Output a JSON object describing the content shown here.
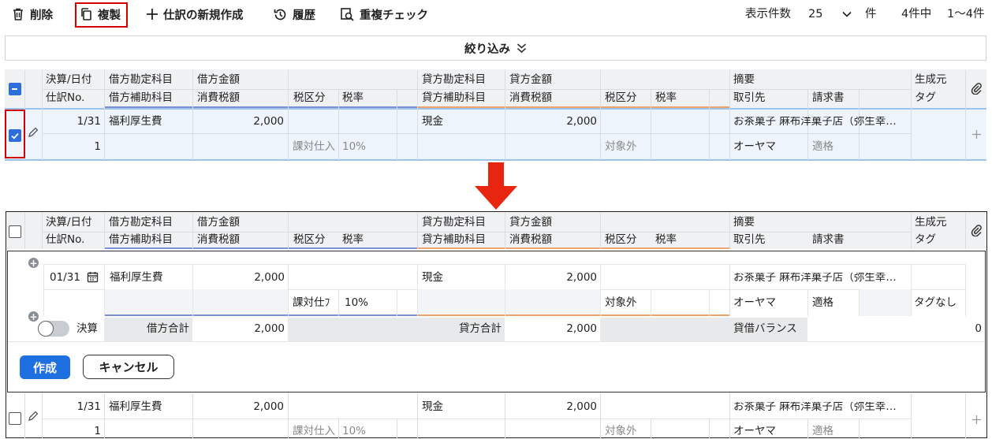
{
  "toolbar": {
    "delete": "削除",
    "duplicate": "複製",
    "new_entry": "仕訳の新規作成",
    "history": "履歴",
    "duplicate_check": "重複チェック",
    "display_count_label": "表示件数",
    "display_count_value": "25",
    "count_unit": "件",
    "total": "4件中",
    "range": "1〜4件"
  },
  "filter": {
    "label": "絞り込み"
  },
  "columns": {
    "date": "決算/日付",
    "entry_no": "仕訳No.",
    "debit_account": "借方勘定科目",
    "debit_sub": "借方補助科目",
    "debit_amount": "借方金額",
    "debit_tax_amount": "消費税額",
    "tax_category": "税区分",
    "tax_rate": "税率",
    "credit_account": "貸方勘定科目",
    "credit_sub": "貸方補助科目",
    "credit_amount": "貸方金額",
    "credit_tax_amount": "消費税額",
    "tax_category2": "税区分",
    "tax_rate2": "税率",
    "memo": "摘要",
    "partner": "取引先",
    "invoice": "請求書",
    "source": "生成元",
    "tag": "タグ"
  },
  "row": {
    "date": "1/31",
    "entry_no": "1",
    "debit_account": "福利厚生費",
    "debit_amount": "2,000",
    "tax_category": "課対仕入",
    "tax_rate": "10%",
    "credit_account": "現金",
    "credit_amount": "2,000",
    "credit_tax_category": "対象外",
    "memo": "お茶菓子 麻布洋菓子店（弥生幸…",
    "partner": "オーヤマ",
    "invoice": "適格"
  },
  "edit": {
    "date": "01/31",
    "debit_account": "福利厚生費",
    "debit_amount": "2,000",
    "tax_category": "課対仕ﾌ",
    "tax_rate": "10%",
    "credit_account": "現金",
    "credit_amount": "2,000",
    "credit_tax_category": "対象外",
    "memo": "お茶菓子 麻布洋菓子店（弥生幸…",
    "partner": "オーヤマ",
    "invoice": "適格",
    "tag": "タグなし",
    "closing_label": "決算",
    "debit_total_label": "借方合計",
    "debit_total": "2,000",
    "credit_total_label": "貸方合計",
    "credit_total": "2,000",
    "balance_label": "貸借バランス",
    "balance": "0",
    "create_button": "作成",
    "cancel_button": "キャンセル"
  },
  "colors": {
    "primary": "#1e6fe0",
    "highlight": "#d40000",
    "arrow": "#e8260f",
    "debit_underline": "#7b8fd6",
    "credit_underline": "#eea36a"
  }
}
